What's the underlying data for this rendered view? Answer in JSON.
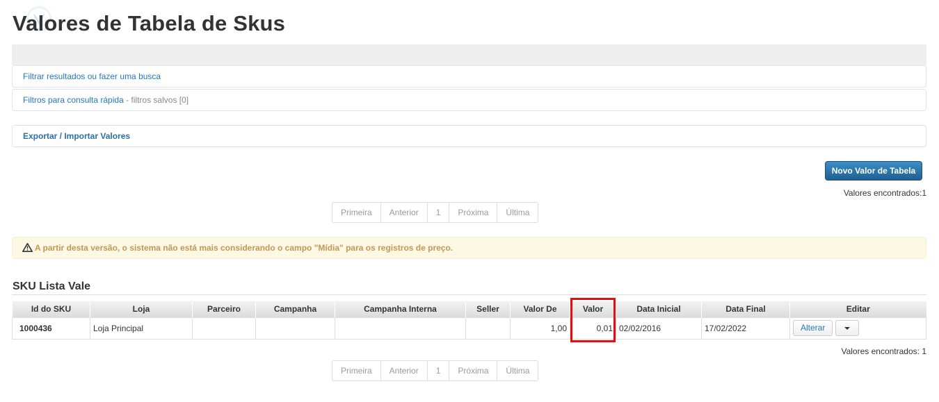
{
  "page": {
    "title": "Valores de Tabela de Skus"
  },
  "panels": {
    "filter_link": "Filtrar resultados ou fazer uma busca",
    "quick_filters_link": "Filtros para consulta rápida",
    "quick_filters_separator": " - ",
    "saved_filters_label": "filtros salvos [0]",
    "export_link": "Exportar / Importar Valores"
  },
  "actions": {
    "new_value_button": "Novo Valor de Tabela"
  },
  "results": {
    "count_top": "Valores encontrados:1",
    "count_bottom": "Valores encontrados: 1"
  },
  "pagination": {
    "first": "Primeira",
    "previous": "Anterior",
    "current": "1",
    "next": "Próxima",
    "last": "Última"
  },
  "alert": {
    "icon": "warning-icon",
    "text": "A partir desta versão, o sistema não está mais considerando o campo \"Mídia\" para os registros de preço."
  },
  "section": {
    "title": "SKU Lista Vale"
  },
  "table": {
    "headers": {
      "id": "Id do SKU",
      "loja": "Loja",
      "parceiro": "Parceiro",
      "campanha": "Campanha",
      "campanha_interna": "Campanha Interna",
      "seller": "Seller",
      "valor_de": "Valor De",
      "valor": "Valor",
      "data_inicial": "Data Inicial",
      "data_final": "Data Final",
      "editar": "Editar"
    },
    "rows": [
      {
        "id": "1000436",
        "loja": "Loja Principal",
        "parceiro": "",
        "campanha": "",
        "campanha_interna": "",
        "seller": "",
        "valor_de": "1,00",
        "valor": "0,01",
        "data_inicial": "02/02/2016",
        "data_final": "17/02/2022",
        "alterar": "Alterar"
      }
    ]
  },
  "colors": {
    "link": "#2277bb",
    "primary": "#1f5f8f",
    "alert_bg": "#fcf8e3",
    "alert_text": "#c09853",
    "highlight": "#e01010"
  }
}
